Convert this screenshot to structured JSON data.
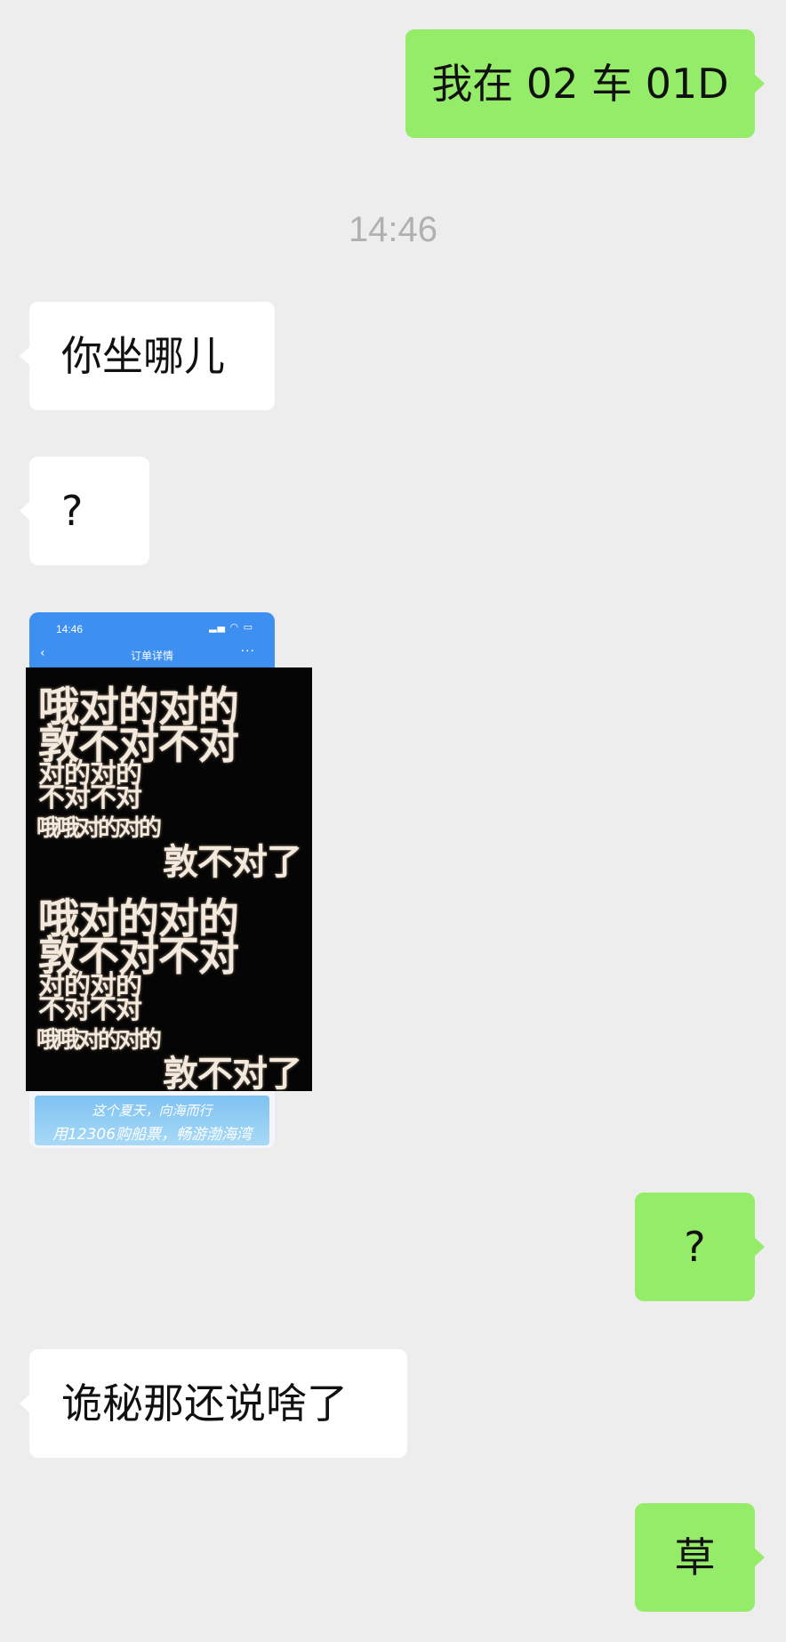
{
  "messages": [
    {
      "side": "out",
      "text": "我在 02 车 01D"
    },
    {
      "side": "in",
      "text": "你坐哪儿"
    },
    {
      "side": "in",
      "text": "?"
    },
    {
      "side": "out",
      "text": "?"
    },
    {
      "side": "in",
      "text": "诡秘那还说啥了"
    },
    {
      "side": "out",
      "text": "草"
    }
  ],
  "timestamp": "14:46",
  "shared_image": {
    "status_time": "14:46",
    "page_title": "订单详情",
    "meme_lines": [
      "哦对的对的",
      "敦不对不对",
      "对的对的",
      "不对不对",
      "哦哦对的对的",
      "敦不对了"
    ],
    "banner_line1": "这个夏天，向海而行",
    "banner_line2": "用12306购船票，畅游渤海湾"
  },
  "colors": {
    "background": "#ededed",
    "outgoing_bubble": "#95ec69",
    "incoming_bubble": "#ffffff",
    "timestamp_text": "#b0b0b0"
  }
}
